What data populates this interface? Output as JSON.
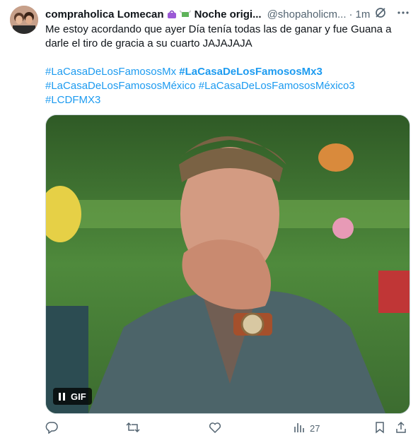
{
  "author": {
    "name": "compraholica Lomecan",
    "emoji_1": "handbag-emoji",
    "emoji_2": "money-with-wings-emoji",
    "display_suffix": "Noche origi...",
    "handle": "@shopaholicm...",
    "dot": "·",
    "time": "1m"
  },
  "tweet": {
    "text": "Me estoy acordando que ayer Día tenía todas las de ganar  y fue Guana a darle el tiro de gracia a su cuarto JAJAJAJA",
    "hashtags": [
      "#LaCasaDeLosFamososMx",
      "#LaCasaDeLosFamososMx3",
      "#LaCasaDeLosFamososMéxico",
      "#LaCasaDeLosFamososMéxico3",
      "#LCDFMX3"
    ]
  },
  "media": {
    "badge_label": "GIF"
  },
  "actions": {
    "views_count": "27"
  },
  "colors": {
    "link": "#1d9bf0",
    "muted": "#536471",
    "text": "#0f1419"
  }
}
